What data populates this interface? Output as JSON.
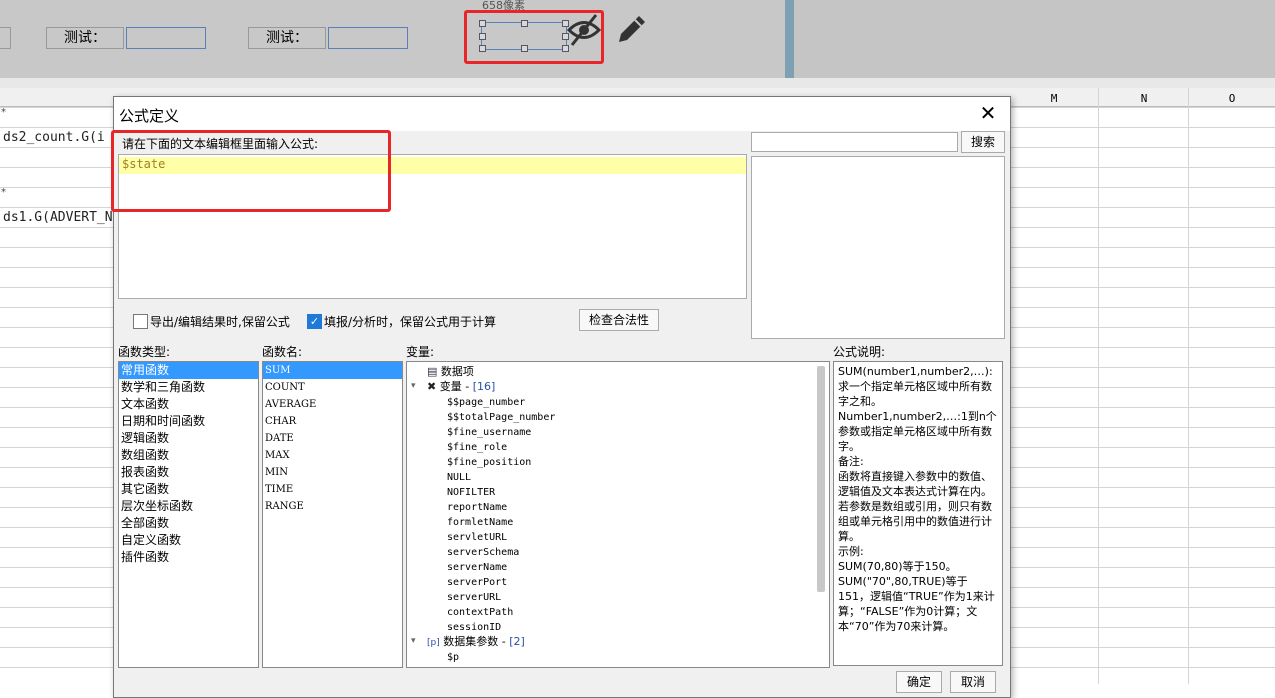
{
  "designer": {
    "label1": "测试：",
    "label2": "测试：",
    "pixel_label": "658像素"
  },
  "sheet": {
    "col_headers": [
      "M",
      "N",
      "O"
    ],
    "cell1": "ds2_count.G(i",
    "cell2": "ds1.G(ADVERT_N",
    "star": "*"
  },
  "dialog": {
    "title": "公式定义",
    "hint": "请在下面的文本编辑框里面输入公式:",
    "formula": "$state",
    "search_placeholder": "",
    "search_btn": "搜索",
    "chk_export_label": "导出/编辑结果时,保留公式",
    "chk_export": false,
    "chk_fill_label": "填报/分析时，保留公式用于计算",
    "chk_fill": true,
    "check_btn": "检查合法性",
    "lbl_types": "函数类型:",
    "lbl_names": "函数名:",
    "lbl_vars": "变量:",
    "lbl_desc": "公式说明:",
    "func_types": [
      "常用函数",
      "数学和三角函数",
      "文本函数",
      "日期和时间函数",
      "逻辑函数",
      "数组函数",
      "报表函数",
      "其它函数",
      "层次坐标函数",
      "全部函数",
      "自定义函数",
      "插件函数"
    ],
    "func_names": [
      "SUM",
      "COUNT",
      "AVERAGE",
      "CHAR",
      "DATE",
      "MAX",
      "MIN",
      "TIME",
      "RANGE"
    ],
    "vars": {
      "data_items": "数据项",
      "variables_label": "变量 - ",
      "variables_count": "[16]",
      "variables": [
        "$$page_number",
        "$$totalPage_number",
        "$fine_username",
        "$fine_role",
        "$fine_position",
        "NULL",
        "NOFILTER",
        "reportName",
        "formletName",
        "servletURL",
        "serverSchema",
        "serverName",
        "serverPort",
        "serverURL",
        "contextPath",
        "sessionID"
      ],
      "dataset_label": "数据集参数 - ",
      "dataset_count": "[2]",
      "dataset_params": [
        "$p"
      ]
    },
    "description": [
      "SUM(number1,number2,…):求一个指定单元格区域中所有数字之和。",
      "Number1,number2,…:1到n个参数或指定单元格区域中所有数字。",
      "备注:",
      "函数将直接键入参数中的数值、逻辑值及文本表达式计算在内。若参数是数组或引用，则只有数组或单元格引用中的数值进行计算。",
      "示例:",
      "SUM(70,80)等于150。",
      "SUM(\"70\",80,TRUE)等于151，逻辑值“TRUE”作为1来计算；“FALSE”作为0计算；文本“70”作为70来计算。"
    ],
    "ok_btn": "确定",
    "cancel_btn": "取消"
  },
  "colors": {
    "highlight": "#e8262a",
    "selection": "#3399ff",
    "editor_line": "#ffffa8"
  }
}
